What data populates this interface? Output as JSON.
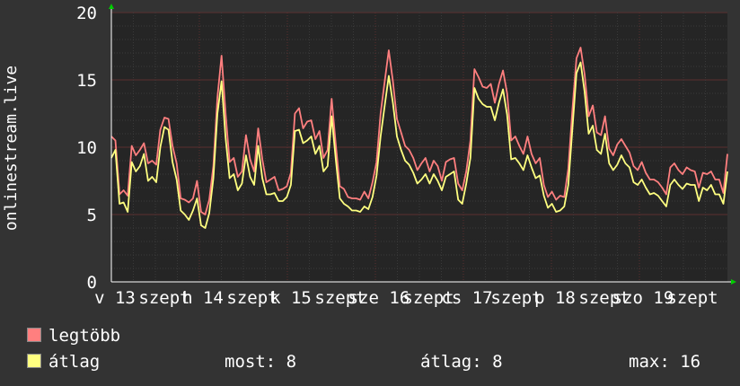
{
  "chart_data": {
    "type": "line",
    "ylabel": "onlinestream.live",
    "ylim": [
      0,
      20
    ],
    "y_ticks": [
      "0",
      "5",
      "10",
      "15",
      "20"
    ],
    "x_tick_labels": [
      "v 13",
      "szept",
      "h 14",
      "szept",
      "k 15",
      "szept",
      "sze 16",
      "szept",
      "cs 17",
      "szept",
      "p 18",
      "szept",
      "szo 19",
      "szept"
    ],
    "grid": true,
    "colors": {
      "background": "#333333",
      "plot_bg": "#252525",
      "grid_minor": "#3a3a3a",
      "grid_major": "#5a3030",
      "axis": "#ffffff",
      "arrow": "#00cc00"
    },
    "series": [
      {
        "name": "legtöbb",
        "color": "#ff7f7f",
        "values": [
          10.8,
          10.5,
          6.5,
          6.8,
          6.4,
          10.1,
          9.4,
          9.8,
          10.3,
          8.8,
          9,
          8.7,
          11.3,
          12.2,
          12.1,
          10.1,
          8.8,
          6.2,
          6.1,
          5.9,
          6.2,
          7.5,
          5.2,
          5,
          6.1,
          8.6,
          13.7,
          16.8,
          12.5,
          8.9,
          9.2,
          7.8,
          8.2,
          10.9,
          9.1,
          8.2,
          11.4,
          9.1,
          7.4,
          7.6,
          7.8,
          6.8,
          6.9,
          7.1,
          8.1,
          12.5,
          12.9,
          11.4,
          11.9,
          12,
          10.6,
          11.2,
          9.2,
          9.8,
          13.6,
          10.2,
          7.1,
          6.9,
          6.3,
          6.2,
          6.2,
          6.1,
          6.7,
          6.2,
          7.4,
          8.9,
          12.5,
          14.9,
          17.2,
          14.9,
          12.1,
          11.1,
          10.1,
          9.8,
          9.2,
          8.3,
          8.8,
          9.2,
          8.2,
          9,
          8.6,
          7.5,
          8.9,
          9.1,
          9.2,
          7.3,
          6.8,
          8.2,
          10.5,
          15.8,
          15.2,
          14.5,
          14.4,
          14.7,
          13.3,
          14.7,
          15.7,
          14,
          10.5,
          10.8,
          10.1,
          9.5,
          10.8,
          9.5,
          8.8,
          9.2,
          7.2,
          6.3,
          6.7,
          6.1,
          6.4,
          6.3,
          8.4,
          12.8,
          16.6,
          17.4,
          15.4,
          12.3,
          13.1,
          11.1,
          10.9,
          12.3,
          9.9,
          9.4,
          10.2,
          10.6,
          10.1,
          9.6,
          8.6,
          8.3,
          8.9,
          8.1,
          7.6,
          7.6,
          7.4,
          7,
          6.5,
          8.5,
          8.8,
          8.3,
          8,
          8.5,
          8.3,
          8.2,
          7,
          8.1,
          8,
          8.2,
          7.6,
          7.6,
          6.6,
          9.5
        ]
      },
      {
        "name": "átlag",
        "color": "#ffff80",
        "values": [
          9.2,
          9.8,
          5.8,
          5.9,
          5.2,
          8.9,
          8.2,
          8.6,
          9.5,
          7.5,
          7.8,
          7.4,
          10,
          11.5,
          11.3,
          8.9,
          7.6,
          5.3,
          5,
          4.6,
          5.3,
          6.2,
          4.2,
          4,
          5.1,
          7.7,
          12.5,
          14.9,
          10.7,
          7.7,
          8,
          6.8,
          7.3,
          9.4,
          7.8,
          7.2,
          10.1,
          7.7,
          6.5,
          6.5,
          6.6,
          6,
          6,
          6.3,
          7.2,
          11.2,
          11.3,
          10.3,
          10.5,
          10.8,
          9.5,
          10.1,
          8.2,
          8.6,
          12.3,
          9.1,
          6.2,
          5.8,
          5.6,
          5.3,
          5.3,
          5.2,
          5.6,
          5.4,
          6.3,
          7.9,
          10.8,
          13.1,
          15.3,
          13.3,
          10.8,
          9.8,
          9,
          8.7,
          8.1,
          7.3,
          7.6,
          8,
          7.3,
          8,
          7.5,
          6.8,
          7.8,
          8,
          8.2,
          6.1,
          5.8,
          7.3,
          9.2,
          14.4,
          13.6,
          13.2,
          13,
          13,
          12,
          13.3,
          14.3,
          12.4,
          9.1,
          9.2,
          8.8,
          8.3,
          9.4,
          8.5,
          7.7,
          7.9,
          6.4,
          5.5,
          5.8,
          5.2,
          5.3,
          5.6,
          7.2,
          11.4,
          15.5,
          16.3,
          14.1,
          11,
          11.6,
          9.8,
          9.5,
          11,
          8.8,
          8.3,
          8.7,
          9.4,
          8.8,
          8.5,
          7.4,
          7.2,
          7.6,
          7,
          6.5,
          6.6,
          6.4,
          6,
          5.6,
          7.2,
          7.6,
          7.2,
          6.9,
          7.3,
          7.2,
          7.2,
          6,
          7,
          6.8,
          7.2,
          6.5,
          6.5,
          5.8,
          8.2
        ]
      }
    ],
    "stats": {
      "most_label": "most:",
      "most_value": "8",
      "avg_label": "átlag:",
      "avg_value": "8",
      "max_label": "max:",
      "max_value": "16"
    }
  }
}
